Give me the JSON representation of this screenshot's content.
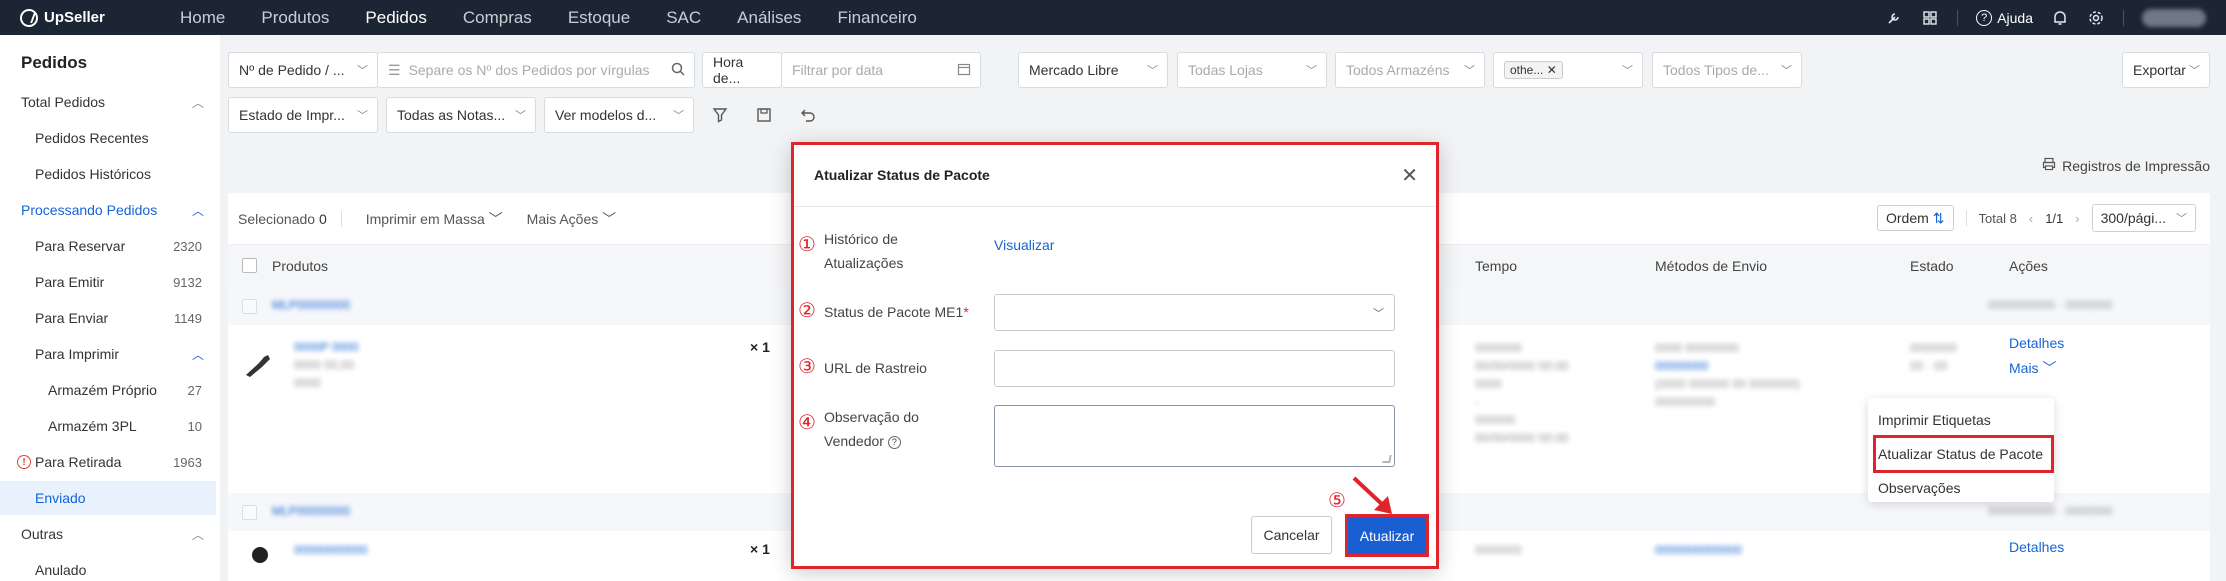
{
  "app": {
    "brand": "UpSeller"
  },
  "nav": {
    "items": [
      "Home",
      "Produtos",
      "Pedidos",
      "Compras",
      "Estoque",
      "SAC",
      "Análises",
      "Financeiro"
    ],
    "active": "Pedidos",
    "help_label": "Ajuda"
  },
  "sidebar": {
    "title": "Pedidos",
    "items": [
      {
        "label": "Total Pedidos",
        "count": "",
        "level": 0,
        "chevron": "^"
      },
      {
        "label": "Pedidos Recentes",
        "count": "",
        "level": 1
      },
      {
        "label": "Pedidos Históricos",
        "count": "",
        "level": 1
      },
      {
        "label": "Processando Pedidos",
        "count": "",
        "level": 0,
        "chevron": "^"
      },
      {
        "label": "Para Reservar",
        "count": "2320",
        "level": 1
      },
      {
        "label": "Para Emitir",
        "count": "9132",
        "level": 1
      },
      {
        "label": "Para Enviar",
        "count": "1149",
        "level": 1
      },
      {
        "label": "Para Imprimir",
        "count": "",
        "level": 1,
        "chevron": "^"
      },
      {
        "label": "Armazém Próprio",
        "count": "27",
        "level": 2
      },
      {
        "label": "Armazém 3PL",
        "count": "10",
        "level": 2
      },
      {
        "label": "Para Retirada",
        "count": "1963",
        "level": 1
      },
      {
        "label": "Enviado",
        "count": "",
        "level": 1
      },
      {
        "label": "Outras",
        "count": "",
        "level": 0,
        "chevron": "^"
      },
      {
        "label": "Anulado",
        "count": "",
        "level": 1
      }
    ]
  },
  "filters": {
    "order_no": "Nº de Pedido / ...",
    "search_placeholder": "Separe os Nº dos Pedidos por vírgulas",
    "time": "Hora de...",
    "date_placeholder": "Filtrar por data",
    "marketplace": "Mercado Libre",
    "stores": "Todas Lojas",
    "warehouses": "Todos Armazéns",
    "tag": "othe...",
    "types": "Todos Tipos de...",
    "export": "Exportar",
    "print_state": "Estado de Impr...",
    "notes": "Todas as Notas...",
    "models": "Ver modelos d..."
  },
  "print_log": "Registros de Impressão",
  "toolbar": {
    "selected_label": "Selecionado",
    "selected_count": "0",
    "mass_print": "Imprimir em Massa",
    "more_actions": "Mais Ações",
    "order": "Ordem",
    "total": "Total 8",
    "page": "1/1",
    "per_page": "300/pági..."
  },
  "table": {
    "headers": [
      "Produtos",
      "Tempo",
      "Métodos de Envio",
      "Estado",
      "Ações"
    ],
    "rows": [
      {
        "quantity": "× 1",
        "details": "Detalhes",
        "more": "Mais"
      },
      {
        "quantity": "× 1",
        "details": "Detalhes"
      }
    ]
  },
  "dropdown_menu": [
    "Imprimir Etiquetas",
    "Atualizar Status de Pacote",
    "Observações"
  ],
  "modal": {
    "title": "Atualizar Status de Pacote",
    "fields": [
      {
        "num": "①",
        "label_line1": "Histórico de",
        "label_line2": "Atualizações",
        "link": "Visualizar"
      },
      {
        "num": "②",
        "label": "Status de Pacote ME1",
        "required": "*"
      },
      {
        "num": "③",
        "label": "URL de Rastreio"
      },
      {
        "num": "④",
        "label_line1": "Observação do",
        "label_line2": "Vendedor"
      }
    ],
    "cancel": "Cancelar",
    "submit": "Atualizar",
    "step5": "⑤"
  },
  "colors": {
    "nav_bg": "#1c2533",
    "primary": "#1a5fd1",
    "highlight": "#e0242c"
  }
}
